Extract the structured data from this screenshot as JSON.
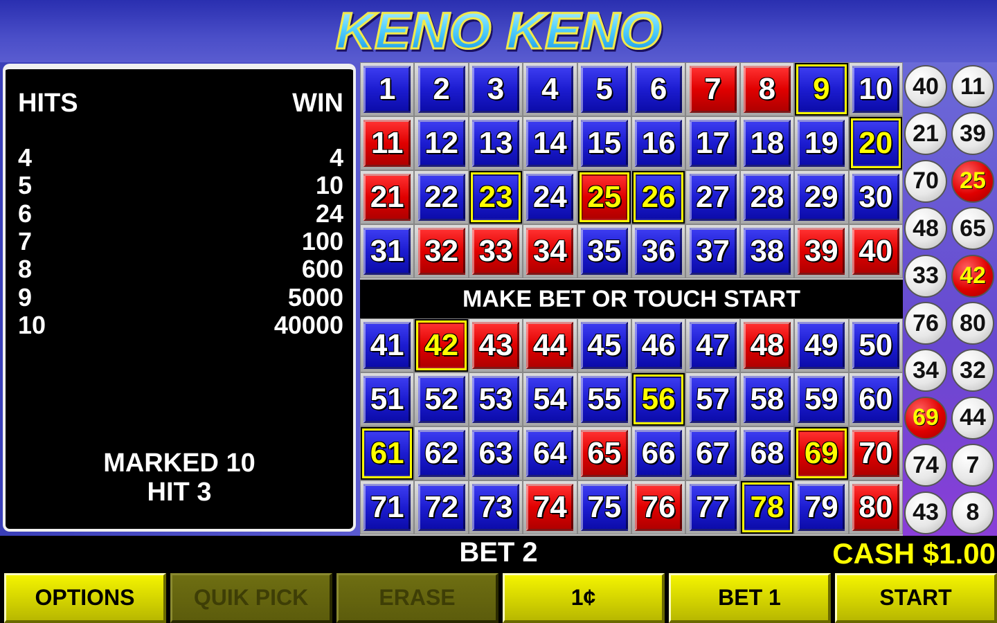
{
  "header": {
    "title": "KENO KENO"
  },
  "paytable": {
    "hits_label": "HITS",
    "win_label": "WIN",
    "rows": [
      {
        "hits": "4",
        "win": "4"
      },
      {
        "hits": "5",
        "win": "10"
      },
      {
        "hits": "6",
        "win": "24"
      },
      {
        "hits": "7",
        "win": "100"
      },
      {
        "hits": "8",
        "win": "600"
      },
      {
        "hits": "9",
        "win": "5000"
      },
      {
        "hits": "10",
        "win": "40000"
      }
    ],
    "marked_text": "MARKED 10",
    "hit_text": "HIT 3"
  },
  "board": {
    "message": "MAKE BET OR TOUCH START",
    "red_numbers": [
      7,
      8,
      11,
      21,
      25,
      32,
      33,
      34,
      39,
      40,
      42,
      43,
      44,
      48,
      65,
      69,
      70,
      74,
      76,
      80
    ],
    "selected_numbers": [
      9,
      20,
      23,
      25,
      26,
      42,
      56,
      61,
      69,
      78
    ]
  },
  "drawn_balls": [
    {
      "number": "40",
      "hit": false
    },
    {
      "number": "11",
      "hit": false
    },
    {
      "number": "21",
      "hit": false
    },
    {
      "number": "39",
      "hit": false
    },
    {
      "number": "70",
      "hit": false
    },
    {
      "number": "25",
      "hit": true
    },
    {
      "number": "48",
      "hit": false
    },
    {
      "number": "65",
      "hit": false
    },
    {
      "number": "33",
      "hit": false
    },
    {
      "number": "42",
      "hit": true
    },
    {
      "number": "76",
      "hit": false
    },
    {
      "number": "80",
      "hit": false
    },
    {
      "number": "34",
      "hit": false
    },
    {
      "number": "32",
      "hit": false
    },
    {
      "number": "69",
      "hit": true
    },
    {
      "number": "44",
      "hit": false
    },
    {
      "number": "74",
      "hit": false
    },
    {
      "number": "7",
      "hit": false
    },
    {
      "number": "43",
      "hit": false
    },
    {
      "number": "8",
      "hit": false
    }
  ],
  "status": {
    "bet_text": "BET 2",
    "cash_text": "CASH $1.00"
  },
  "buttons": [
    {
      "id": "options",
      "label": "OPTIONS",
      "enabled": true
    },
    {
      "id": "quik-pick",
      "label": "QUIK PICK",
      "enabled": false
    },
    {
      "id": "erase",
      "label": "ERASE",
      "enabled": false
    },
    {
      "id": "denomination",
      "label": "1¢",
      "enabled": true
    },
    {
      "id": "bet-1",
      "label": "BET 1",
      "enabled": true
    },
    {
      "id": "start",
      "label": "START",
      "enabled": true
    }
  ],
  "colors": {
    "accent_yellow": "#ffff00",
    "tile_blue": "#1c1cd0",
    "tile_red": "#e00000",
    "header_purple": "#3a3fc0"
  }
}
